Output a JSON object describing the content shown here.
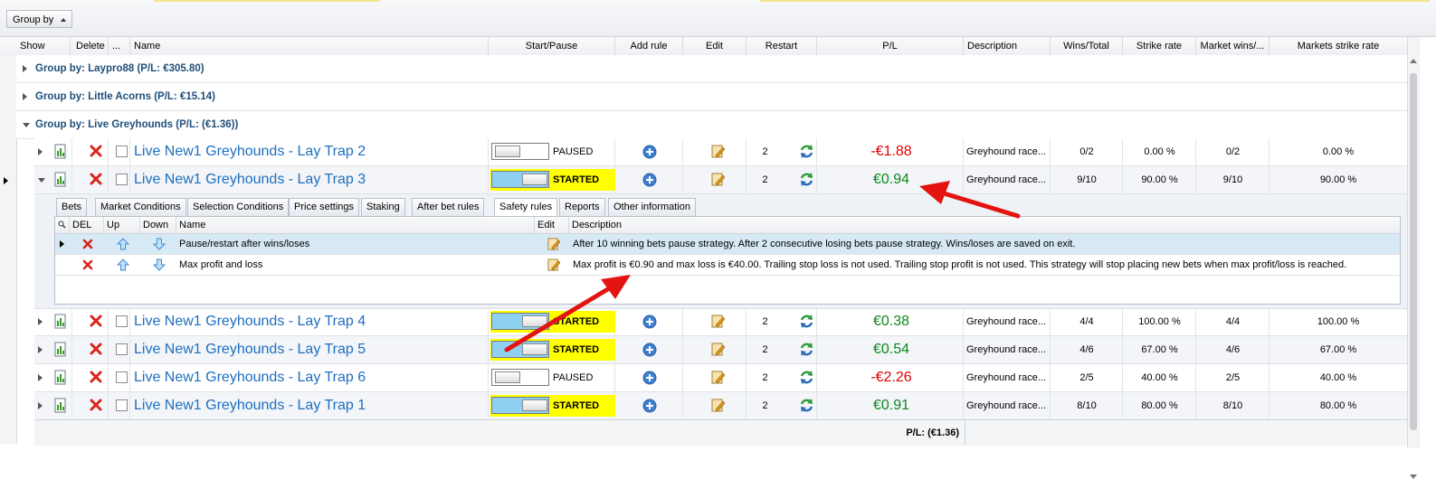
{
  "toolbar": {
    "group_by_label": "Group by"
  },
  "columns": {
    "show": "Show",
    "delete": "Delete",
    "more": "...",
    "name": "Name",
    "start_pause": "Start/Pause",
    "add_rule": "Add rule",
    "edit": "Edit",
    "restart": "Restart",
    "pl": "P/L",
    "description": "Description",
    "wins_total": "Wins/Total",
    "strike_rate": "Strike rate",
    "market_wins": "Market wins/...",
    "markets_strike_rate": "Markets strike rate"
  },
  "groups": [
    {
      "label": "Group by: Laypro88 (P/L: €305.80)"
    },
    {
      "label": "Group by: Little Acorns (P/L: €15.14)"
    },
    {
      "label": "Group by: Live Greyhounds (P/L: (€1.36))"
    }
  ],
  "rows": [
    {
      "name": "Live New1 Greyhounds - Lay Trap 2",
      "state": "PAUSED",
      "restart": "2",
      "pl": "-€1.88",
      "desc": "Greyhound race...",
      "wins": "0/2",
      "strike": "0.00 %",
      "mwins": "0/2",
      "mstrike": "0.00 %"
    },
    {
      "name": "Live New1 Greyhounds - Lay Trap 3",
      "state": "STARTED",
      "restart": "2",
      "pl": "€0.94",
      "desc": "Greyhound race...",
      "wins": "9/10",
      "strike": "90.00 %",
      "mwins": "9/10",
      "mstrike": "90.00 %"
    },
    {
      "name": "Live New1 Greyhounds - Lay Trap 4",
      "state": "STARTED",
      "restart": "2",
      "pl": "€0.38",
      "desc": "Greyhound race...",
      "wins": "4/4",
      "strike": "100.00 %",
      "mwins": "4/4",
      "mstrike": "100.00 %"
    },
    {
      "name": "Live New1 Greyhounds - Lay Trap 5",
      "state": "STARTED",
      "restart": "2",
      "pl": "€0.54",
      "desc": "Greyhound race...",
      "wins": "4/6",
      "strike": "67.00 %",
      "mwins": "4/6",
      "mstrike": "67.00 %"
    },
    {
      "name": "Live New1 Greyhounds - Lay Trap 6",
      "state": "PAUSED",
      "restart": "2",
      "pl": "-€2.26",
      "desc": "Greyhound race...",
      "wins": "2/5",
      "strike": "40.00 %",
      "mwins": "2/5",
      "mstrike": "40.00 %"
    },
    {
      "name": "Live New1 Greyhounds - Lay Trap 1",
      "state": "STARTED",
      "restart": "2",
      "pl": "€0.91",
      "desc": "Greyhound race...",
      "wins": "8/10",
      "strike": "80.00 %",
      "mwins": "8/10",
      "mstrike": "80.00 %"
    }
  ],
  "detail": {
    "tabs": [
      "Bets",
      "Market Conditions",
      "Selection Conditions",
      "Price settings",
      "Staking",
      "After bet rules",
      "Safety rules",
      "Reports",
      "Other information"
    ],
    "active_tab": "Safety rules",
    "columns": {
      "search": "",
      "del": "DEL",
      "up": "Up",
      "down": "Down",
      "name": "Name",
      "edit": "Edit",
      "description": "Description"
    },
    "rules": [
      {
        "name": "Pause/restart after wins/loses",
        "description": "After 10 winning bets pause strategy. After 2 consecutive losing bets pause strategy. Wins/loses are saved on exit."
      },
      {
        "name": "Max profit and loss",
        "description": "Max profit is €0.90 and max loss is €40.00. Trailing stop loss is not used. Trailing stop profit is not used. This strategy will stop placing new bets when max profit/loss is reached."
      }
    ]
  },
  "footer": {
    "total": "P/L: (€1.36)"
  },
  "colors": {
    "started_bg": "#ffff00",
    "positive": "#0a8a1a",
    "negative": "#e00000",
    "link": "#1f6fbf",
    "annotation_arrow": "#e3140f"
  }
}
